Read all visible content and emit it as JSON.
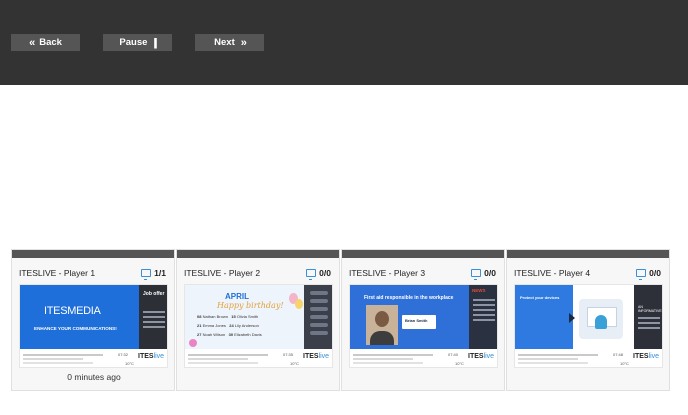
{
  "toolbar": {
    "back_label": "Back",
    "pause_label": "Pause",
    "next_label": "Next",
    "back_icon": "double-chevron-left-icon",
    "pause_icon": "pause-icon",
    "next_icon": "double-chevron-right-icon"
  },
  "players": [
    {
      "name": "ITESLIVE - Player 1",
      "count": "1/1",
      "last_seen": "0 minutes ago",
      "thumb": {
        "logo_bold": "ITES",
        "logo_light": "MEDIA",
        "tagline": "ENHANCE YOUR COMMUNICATIONS!",
        "side_title": "Job offer",
        "time": "07:32",
        "temp": "10°C",
        "brand": "ITES",
        "brand_suffix": "live"
      }
    },
    {
      "name": "ITESLIVE - Player 2",
      "count": "0/0",
      "last_seen": "",
      "thumb": {
        "month": "APRIL",
        "greeting": "Happy birthday!",
        "birthdays": [
          [
            "08",
            "Nathan Brown",
            "15",
            "Olivia Smith"
          ],
          [
            "21",
            "Emma Jones",
            "24",
            "Lily Anderson"
          ],
          [
            "27",
            "Noah Wilson",
            "30",
            "Elizabeth Davis"
          ]
        ],
        "time": "07:35",
        "temp": "10°C",
        "brand": "ITES",
        "brand_suffix": "live"
      }
    },
    {
      "name": "ITESLIVE - Player 3",
      "count": "0/0",
      "last_seen": "",
      "thumb": {
        "headline": "First aid responsible in the workplace",
        "person_name": "Brian Smith",
        "side_title": "NEWS",
        "time": "07:40",
        "temp": "10°C",
        "brand": "ITES",
        "brand_suffix": "live"
      }
    },
    {
      "name": "ITESLIVE - Player 4",
      "count": "0/0",
      "last_seen": "",
      "thumb": {
        "headline": "Protect your devices",
        "side_title": "AN INFORMATIVE",
        "time": "07:48",
        "temp": "10°C",
        "brand": "ITES",
        "brand_suffix": "live"
      }
    }
  ],
  "colors": {
    "topbar": "#333333",
    "button": "#555555",
    "accent": "#3a8fd6"
  }
}
